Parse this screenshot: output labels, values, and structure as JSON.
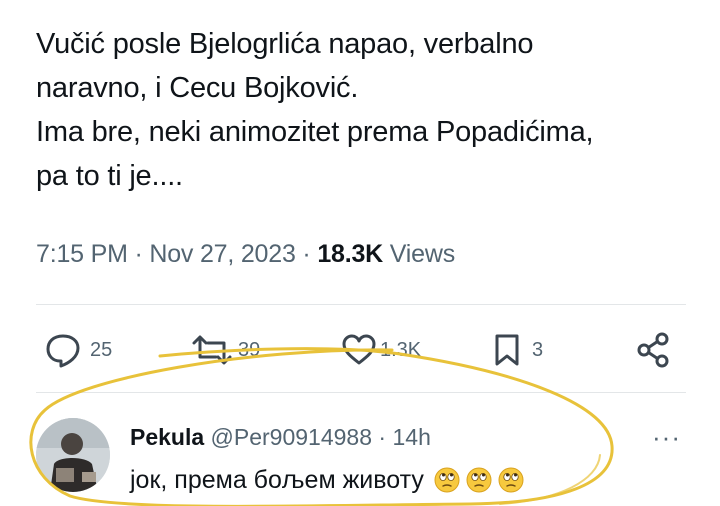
{
  "tweet": {
    "lines": [
      "Vučić posle Bjelogrlića napao, verbalno",
      "naravno, i Cecu Bojković.",
      "Ima bre, neki animozitet prema Popadićima,",
      "pa to ti je...."
    ],
    "time": "7:15 PM",
    "separator": "·",
    "date": "Nov 27, 2023",
    "views_count": "18.3K",
    "views_label": "Views"
  },
  "actions": {
    "replies": "25",
    "reposts": "39",
    "likes": "1.3K",
    "bookmarks": "3",
    "icons": [
      "reply-icon",
      "repost-icon",
      "like-icon",
      "bookmark-icon",
      "share-icon"
    ]
  },
  "reply": {
    "name": "Pekula",
    "handle": "@Per90914988",
    "separator": "·",
    "age": "14h",
    "text": "јок, према бољем животу",
    "more": "···",
    "emoji_icons": [
      "rolling-eyes-emoji-icon",
      "rolling-eyes-emoji-icon",
      "rolling-eyes-emoji-icon"
    ]
  },
  "colors": {
    "text": "#0f1419",
    "secondary": "#536471",
    "divider": "#e3e6e8",
    "highlight_circle": "#e8c23a",
    "emoji_yellow": "#f7c93e"
  }
}
